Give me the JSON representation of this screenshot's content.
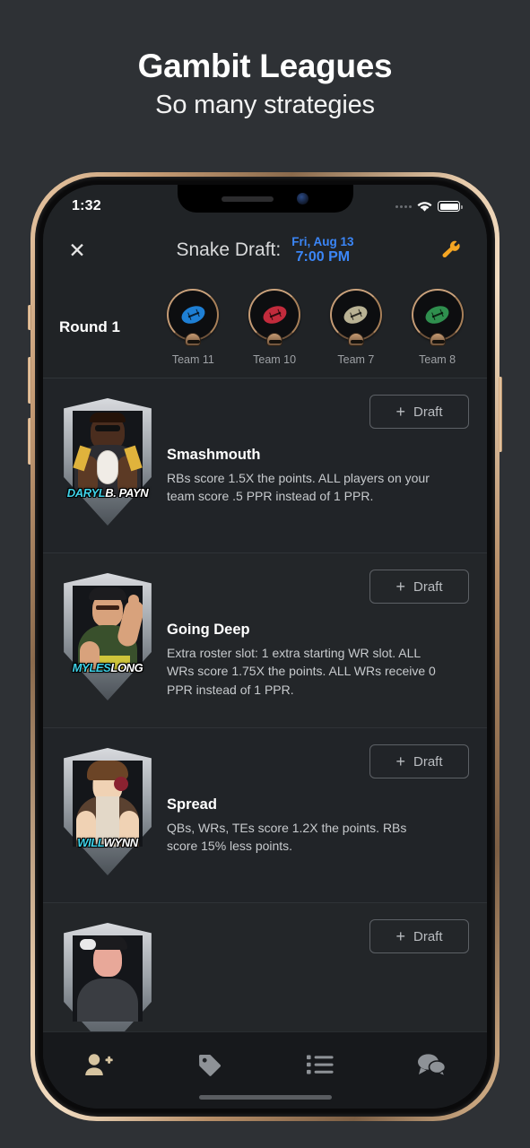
{
  "promo": {
    "title": "Gambit Leagues",
    "subtitle": "So many strategies"
  },
  "phone": {
    "status_bar": {
      "time": "1:32",
      "signal_icon": "signal-dots-icon",
      "wifi_icon": "wifi-icon",
      "battery_icon": "battery-full-icon"
    },
    "home_indicator": "home-indicator"
  },
  "navbar": {
    "close_label": "✕",
    "title": "Snake Draft:",
    "date": "Fri, Aug 13",
    "time": "7:00 PM",
    "settings_icon": "wrench-icon",
    "accent_blue": "#3b86f7",
    "accent_orange": "#f5a623"
  },
  "round_strip": {
    "round_label": "Round 1",
    "teams": [
      {
        "name": "Team 11",
        "ball_color": "#1e7fd4",
        "icon": "football-icon"
      },
      {
        "name": "Team 10",
        "ball_color": "#c22b3c",
        "icon": "football-icon"
      },
      {
        "name": "Team 7",
        "ball_color": "#b9b294",
        "icon": "football-icon"
      },
      {
        "name": "Team 8",
        "ball_color": "#2f8f4e",
        "icon": "football-icon"
      }
    ]
  },
  "strategies": [
    {
      "title": "Smashmouth",
      "description": "RBs score 1.5X the points. ALL players on your team score .5 PPR instead of 1 PPR.",
      "player_first": "DARYL",
      "player_last": "B. PAYN",
      "draft_label": "Draft",
      "draft_plus": "+"
    },
    {
      "title": "Going Deep",
      "description": "Extra roster slot: 1 extra starting WR slot. ALL WRs score 1.75X the points. ALL WRs receive 0 PPR instead of 1 PPR.",
      "player_first": "MYLES",
      "player_last": "LONG",
      "draft_label": "Draft",
      "draft_plus": "+"
    },
    {
      "title": "Spread",
      "description": "QBs, WRs, TEs score 1.2X the points. RBs score 15% less points.",
      "player_first": "WILL",
      "player_last": "WYNN",
      "draft_label": "Draft",
      "draft_plus": "+"
    },
    {
      "title": "",
      "description": "",
      "player_first": "",
      "player_last": "",
      "draft_label": "Draft",
      "draft_plus": "+"
    }
  ],
  "tabbar": {
    "active_color": "#d6c4a0",
    "inactive_color": "#8e9297",
    "tabs": [
      {
        "icon": "add-person-icon",
        "active": true
      },
      {
        "icon": "tag-icon",
        "active": false
      },
      {
        "icon": "list-icon",
        "active": false
      },
      {
        "icon": "chat-bubbles-icon",
        "active": false
      }
    ]
  }
}
